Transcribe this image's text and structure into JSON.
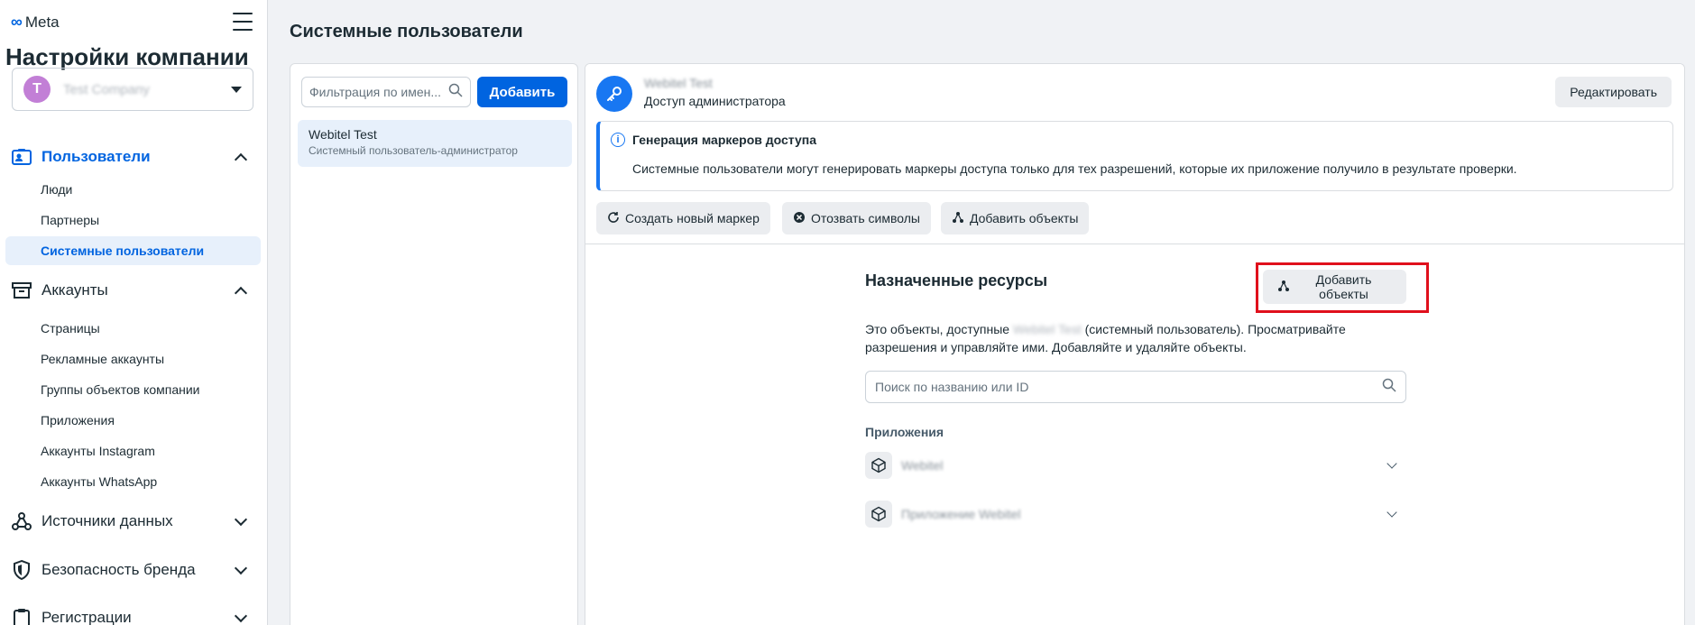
{
  "brand": {
    "logo_text": "Meta"
  },
  "sidebar": {
    "title": "Настройки компании",
    "account": {
      "avatar_letter": "T",
      "name": "Test Company"
    },
    "sections": [
      {
        "label": "Пользователи",
        "items": [
          "Люди",
          "Партнеры",
          "Системные пользователи"
        ]
      },
      {
        "label": "Аккаунты",
        "items": [
          "Страницы",
          "Рекламные аккаунты",
          "Группы объектов компании",
          "Приложения",
          "Аккаунты Instagram",
          "Аккаунты WhatsApp"
        ]
      },
      {
        "label": "Источники данных"
      },
      {
        "label": "Безопасность бренда"
      },
      {
        "label": "Регистрации"
      }
    ]
  },
  "main": {
    "page_title": "Системные пользователи",
    "list": {
      "filter_placeholder": "Фильтрация по имен...",
      "add_label": "Добавить",
      "users": [
        {
          "name": "Webitel Test",
          "role": "Системный пользователь-администратор"
        }
      ]
    },
    "detail": {
      "user_name": "Webitel Test",
      "access": "Доступ администратора",
      "edit_label": "Редактировать",
      "info_title": "Генерация маркеров доступа",
      "info_text": "Системные пользователи могут генерировать маркеры доступа только для тех разрешений, которые их приложение получило в результате проверки.",
      "actions": [
        "Создать новый маркер",
        "Отозвать символы",
        "Добавить объекты"
      ],
      "resources": {
        "title": "Назначенные ресурсы",
        "add_label": "Добавить объекты",
        "desc_prefix": "Это объекты, доступные ",
        "desc_name": "Webitel Test",
        "desc_suffix": " (системный пользователь). Просматривайте разрешения и управляйте ими. Добавляйте и удаляйте объекты.",
        "search_placeholder": "Поиск по названию или ID",
        "apps_label": "Приложения",
        "apps": [
          "Webitel",
          "Приложение Webitel"
        ]
      }
    }
  },
  "colors": {
    "accent": "#0064e0",
    "highlight": "#e0101c",
    "avatar": "#c27fd6"
  }
}
